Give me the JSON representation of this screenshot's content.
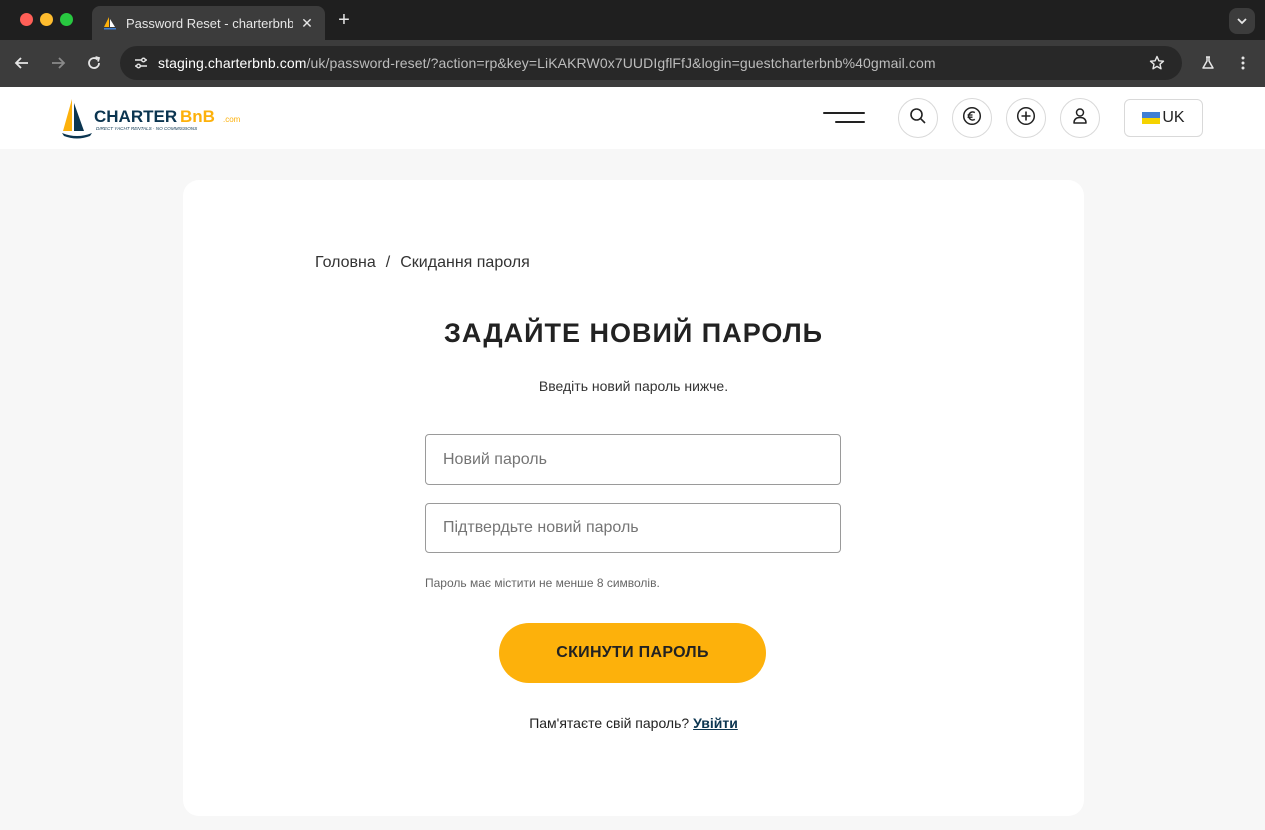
{
  "browser": {
    "tab_title": "Password Reset - charterbnb",
    "url_host": "staging.charterbnb.com",
    "url_path": "/uk/password-reset/?action=rp&key=LiKAKRW0x7UUDIgflFfJ&login=guestcharterbnb%40gmail.com"
  },
  "site": {
    "logo": {
      "text_main": "CHARTER",
      "text_accent": "BnB",
      "text_suffix": ".com",
      "tagline": "DIRECT YACHT RENTALS · NO COMMISSIONS"
    },
    "language_label": "UK"
  },
  "page": {
    "breadcrumb": {
      "home": "Головна",
      "separator": "/",
      "current": "Скидання пароля"
    },
    "heading": "ЗАДАЙТЕ НОВИЙ ПАРОЛЬ",
    "subtext": "Введіть новий пароль нижче.",
    "new_password_placeholder": "Новий пароль",
    "confirm_password_placeholder": "Підтвердьте новий пароль",
    "hint": "Пароль має містити не менше 8 символів.",
    "submit_label": "СКИНУТИ ПАРОЛЬ",
    "remember_text": "Пам'ятаєте свій пароль?",
    "login_link": "Увійти"
  },
  "colors": {
    "accent": "#fdb10b",
    "brand_navy": "#0b3550"
  }
}
